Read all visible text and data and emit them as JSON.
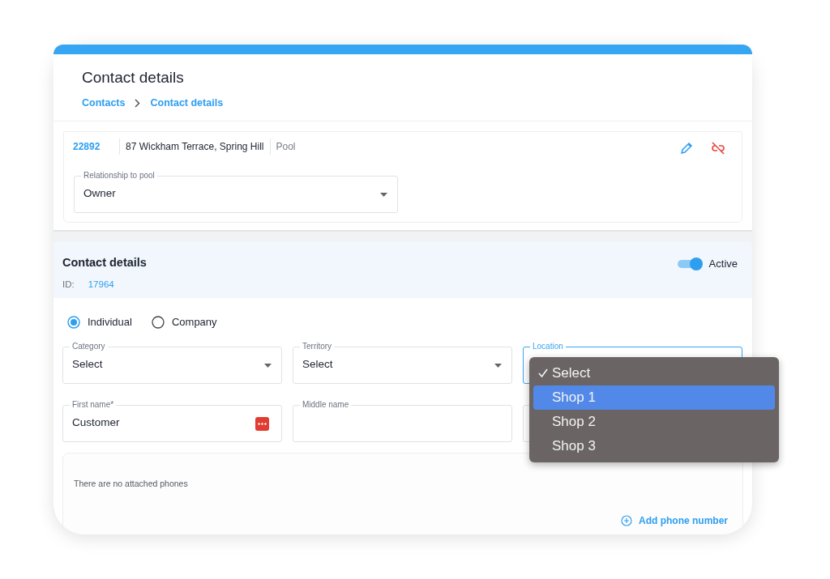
{
  "page_title": "Contact details",
  "breadcrumb": [
    "Contacts",
    "Contact details"
  ],
  "pool": {
    "id": "22892",
    "address": "87 Wickham Terrace, Spring Hill",
    "type": "Pool",
    "relationship": {
      "label": "Relationship to pool",
      "value": "Owner"
    }
  },
  "contact": {
    "title": "Contact details",
    "id_label": "ID:",
    "id_value": "17964",
    "active": {
      "label": "Active",
      "on": true
    }
  },
  "contact_type": [
    {
      "label": "Individual",
      "selected": true
    },
    {
      "label": "Company",
      "selected": false
    }
  ],
  "fields": [
    {
      "kind": "select",
      "label": "Category",
      "value": "Select",
      "focused": false
    },
    {
      "kind": "select",
      "label": "Territory",
      "value": "Select",
      "focused": false
    },
    {
      "kind": "select",
      "label": "Location",
      "focused": true
    },
    {
      "kind": "text",
      "label": "First name*",
      "value": "Customer",
      "focused": false
    },
    {
      "kind": "text",
      "label": "Middle name",
      "focused": false
    },
    {
      "kind": "text",
      "focused": false
    }
  ],
  "dropdown": [
    {
      "label": "Select",
      "checked": true,
      "selected": false
    },
    {
      "label": "Shop 1",
      "checked": false,
      "selected": true
    },
    {
      "label": "Shop 2",
      "checked": false,
      "selected": false
    },
    {
      "label": "Shop 3",
      "checked": false,
      "selected": false
    }
  ],
  "phones": {
    "empty_text": "There are no attached phones",
    "add_label": "Add phone number"
  }
}
